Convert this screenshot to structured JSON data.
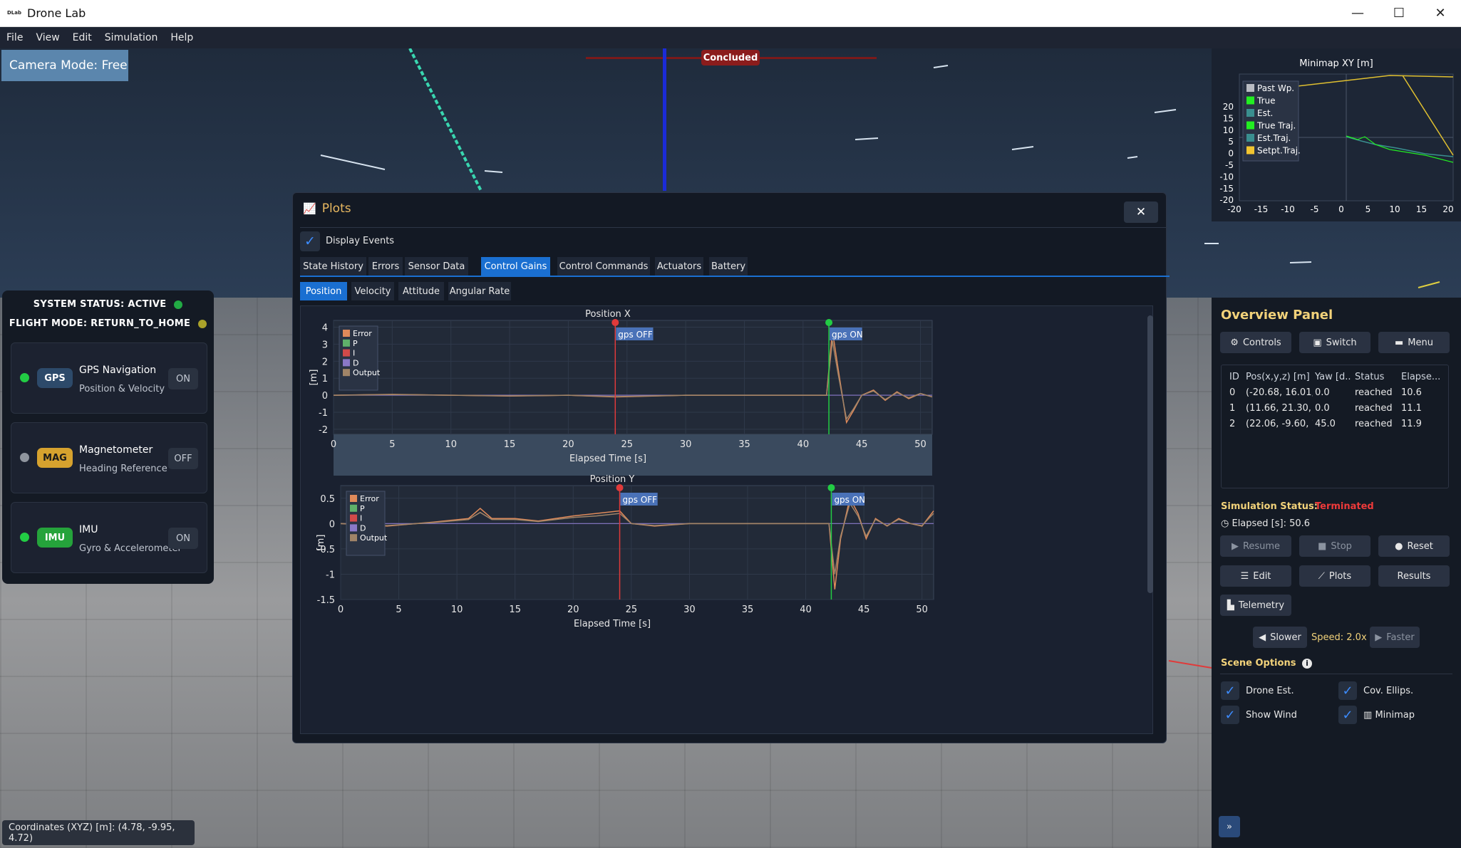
{
  "window": {
    "title": "Drone Lab",
    "logo": "DLab",
    "min": "—",
    "max": "☐",
    "close": "✕"
  },
  "menu": [
    "File",
    "View",
    "Edit",
    "Simulation",
    "Help"
  ],
  "camera_mode": "Camera Mode: Free",
  "concluded": "Concluded",
  "status": {
    "system": "SYSTEM STATUS: ACTIVE",
    "flight": "FLIGHT MODE: RETURN_TO_HOME",
    "sensors": [
      {
        "badge": "GPS",
        "name": "GPS Navigation",
        "sub": "Position & Velocity",
        "toggle": "ON",
        "dot": "#22cc44",
        "badge_bg": "#2d4a6a",
        "badge_fg": "#ffffff"
      },
      {
        "badge": "MAG",
        "name": "Magnetometer",
        "sub": "Heading Reference",
        "toggle": "OFF",
        "dot": "#8f959e",
        "badge_bg": "#d6a22e",
        "badge_fg": "#1a1a1a"
      },
      {
        "badge": "IMU",
        "name": "IMU",
        "sub": "Gyro & Accelerometer",
        "toggle": "ON",
        "dot": "#22cc44",
        "badge_bg": "#25a33b",
        "badge_fg": "#ffffff"
      }
    ]
  },
  "coordinates": "Coordinates (XYZ) [m]: (4.78, -9.95, 4.72)",
  "minimap": {
    "title": "Minimap XY [m]",
    "legend": [
      "Past Wp.",
      "True",
      "Est.",
      "True Traj.",
      "Est.Traj.",
      "Setpt.Traj."
    ],
    "legend_colors": [
      "#b9bcc2",
      "#22ee22",
      "#3a8f8f",
      "#22ee22",
      "#3a8f8f",
      "#f2c530"
    ],
    "yticks": [
      "20",
      "15",
      "10",
      "5",
      "0",
      "-5",
      "-10",
      "-15",
      "-20"
    ],
    "xticks": [
      "-20",
      "-15",
      "-10",
      "-5",
      "0",
      "5",
      "10",
      "15",
      "20"
    ]
  },
  "plots": {
    "title": "Plots",
    "close": "✕",
    "display_events": "Display Events",
    "tabs": [
      "State History",
      "Errors",
      "Sensor Data",
      "Control Gains",
      "Control Commands",
      "Actuators",
      "Battery"
    ],
    "subtabs": [
      "Position",
      "Velocity",
      "Attitude",
      "Angular Rate"
    ]
  },
  "chart_data": [
    {
      "type": "line",
      "title": "Position X",
      "xlabel": "Elapsed Time [s]",
      "ylabel": "[m]",
      "xlim": [
        0,
        51
      ],
      "ylim": [
        -2.3,
        4.4
      ],
      "xticks": [
        "0",
        "5",
        "10",
        "15",
        "20",
        "25",
        "30",
        "35",
        "40",
        "45",
        "50"
      ],
      "yticks": [
        "4",
        "3",
        "2",
        "1",
        "0",
        "-1",
        "-2"
      ],
      "legend": [
        "Error",
        "P",
        "I",
        "D",
        "Output"
      ],
      "legend_colors": [
        "#e08a5a",
        "#5fb06a",
        "#d24a4a",
        "#8a78c8",
        "#a08468"
      ],
      "events": [
        {
          "x": 24,
          "label": "gps OFF",
          "color": "#e03a3a"
        },
        {
          "x": 42.2,
          "label": "gps ON",
          "color": "#22cc44"
        }
      ],
      "series": [
        {
          "name": "Error",
          "x": [
            0,
            5,
            10,
            15,
            20,
            24,
            30,
            35,
            42,
            42.5,
            43,
            43.7,
            44.3,
            45,
            46,
            47,
            48,
            49,
            50,
            51
          ],
          "y": [
            0,
            0.05,
            0,
            -0.05,
            0,
            -0.1,
            0,
            0,
            0,
            3.8,
            1.5,
            -1.6,
            -0.9,
            0,
            0.3,
            -0.3,
            0.2,
            -0.2,
            0.1,
            -0.1
          ]
        },
        {
          "name": "Output",
          "x": [
            0,
            5,
            10,
            15,
            20,
            24,
            30,
            35,
            42,
            42.5,
            43,
            43.7,
            44.3,
            45,
            46,
            47,
            48,
            49,
            50,
            51
          ],
          "y": [
            0,
            0.04,
            0,
            -0.04,
            0,
            -0.08,
            0,
            0,
            0,
            3.2,
            1.2,
            -1.4,
            -0.8,
            0,
            0.25,
            -0.25,
            0.15,
            -0.15,
            0.1,
            -0.1
          ]
        }
      ]
    },
    {
      "type": "line",
      "title": "Position Y",
      "xlabel": "Elapsed Time [s]",
      "ylabel": "[m]",
      "xlim": [
        0,
        51
      ],
      "ylim": [
        -1.5,
        0.75
      ],
      "xticks": [
        "0",
        "5",
        "10",
        "15",
        "20",
        "25",
        "30",
        "35",
        "40",
        "45",
        "50"
      ],
      "yticks": [
        "0.5",
        "0",
        "-0.5",
        "-1",
        "-1.5"
      ],
      "legend": [
        "Error",
        "P",
        "I",
        "D",
        "Output"
      ],
      "legend_colors": [
        "#e08a5a",
        "#5fb06a",
        "#d24a4a",
        "#8a78c8",
        "#a08468"
      ],
      "events": [
        {
          "x": 24,
          "label": "gps OFF",
          "color": "#e03a3a"
        },
        {
          "x": 42.2,
          "label": "gps ON",
          "color": "#22cc44"
        }
      ],
      "series": [
        {
          "name": "Error",
          "x": [
            0,
            4,
            8,
            11,
            12,
            13,
            15,
            17,
            20,
            22,
            24,
            25,
            27,
            30,
            35,
            42,
            42.5,
            43,
            43.8,
            44.5,
            45.2,
            46,
            47,
            48,
            49,
            50,
            51
          ],
          "y": [
            0,
            -0.05,
            0.03,
            0.1,
            0.3,
            0.1,
            0.1,
            0.05,
            0.15,
            0.2,
            0.25,
            0,
            -0.05,
            0,
            0,
            0,
            -1.3,
            -0.3,
            0.5,
            0.2,
            -0.3,
            0.1,
            -0.05,
            0.1,
            0,
            -0.05,
            0.25
          ]
        },
        {
          "name": "Output",
          "x": [
            0,
            4,
            8,
            11,
            12,
            13,
            15,
            17,
            20,
            22,
            24,
            25,
            27,
            30,
            35,
            42,
            42.5,
            43,
            43.8,
            44.5,
            45.2,
            46,
            47,
            48,
            49,
            50,
            51
          ],
          "y": [
            0,
            -0.04,
            0.02,
            0.08,
            0.22,
            0.08,
            0.08,
            0.04,
            0.12,
            0.15,
            0.2,
            0,
            -0.04,
            0,
            0,
            0,
            -1.0,
            -0.25,
            0.4,
            0.15,
            -0.25,
            0.08,
            -0.04,
            0.08,
            0,
            -0.04,
            0.2
          ]
        }
      ]
    }
  ],
  "overview": {
    "title": "Overview Panel",
    "controls": "Controls",
    "switch": "Switch",
    "menu": "Menu",
    "table_headers": [
      "ID",
      "Pos(x,y,z) [m]",
      "Yaw [d...",
      "Status",
      "Elapse..."
    ],
    "rows": [
      [
        "0",
        "(-20.68, 16.01,",
        "0.0",
        "reached",
        "10.6"
      ],
      [
        "1",
        "(11.66, 21.30, 1",
        "0.0",
        "reached",
        "11.1"
      ],
      [
        "2",
        "(22.06, -9.60, 1",
        "45.0",
        "reached",
        "11.9"
      ]
    ],
    "sim_status_label": "Simulation Status:",
    "sim_status": "Terminated",
    "elapsed": "Elapsed [s]: 50.6",
    "resume": "Resume",
    "stop": "Stop",
    "reset": "Reset",
    "edit": "Edit",
    "plots": "Plots",
    "results": "Results",
    "telemetry": "Telemetry",
    "slower": "Slower",
    "speed": "Speed: 2.0x",
    "faster": "Faster",
    "scene_options": "Scene Options",
    "opt_drone_est": "Drone Est.",
    "opt_cov": "Cov. Ellips.",
    "opt_wind": "Show Wind",
    "opt_minimap": "Minimap",
    "expand": "»"
  }
}
